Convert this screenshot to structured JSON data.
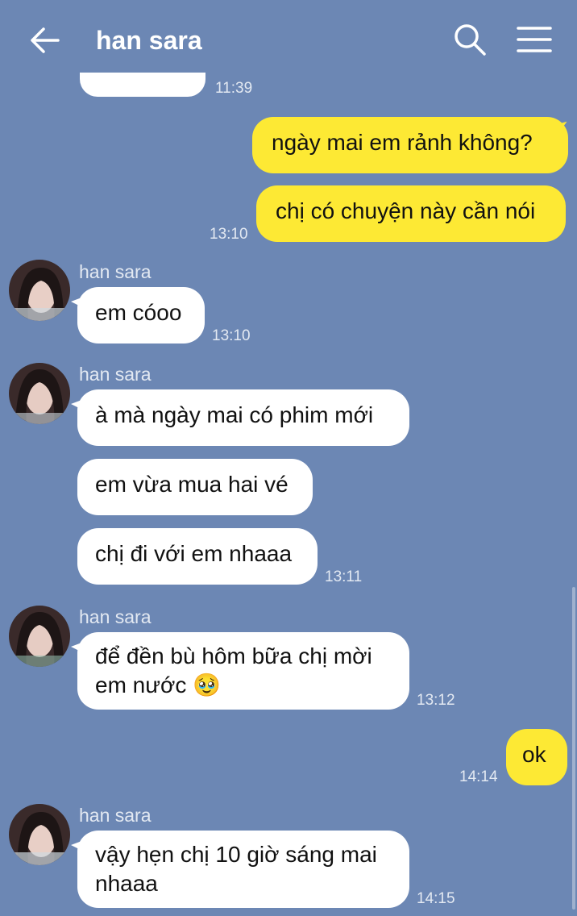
{
  "header": {
    "title": "han sara"
  },
  "partial_top": {
    "time": "11:39"
  },
  "messages": {
    "out1": {
      "text": "ngày mai em rảnh không?"
    },
    "out2": {
      "text": "chị có chuyện này cần nói",
      "time": "13:10"
    },
    "in1": {
      "sender": "han sara",
      "text": "em cóoo",
      "time": "13:10"
    },
    "in2": {
      "sender": "han sara",
      "text1": "à mà ngày mai có phim mới",
      "text2": "em vừa mua hai vé",
      "text3": "chị đi với em nhaaa",
      "time": "13:11"
    },
    "in3": {
      "sender": "han sara",
      "line1": "để đền bù hôm bữa chị mời",
      "line2": "em nước 🥹",
      "time": "13:12"
    },
    "out3": {
      "text": "ok",
      "time": "14:14"
    },
    "in4": {
      "sender": "han sara",
      "line1": "vậy hẹn chị 10 giờ sáng mai",
      "line2": "nhaaa",
      "time": "14:15"
    }
  },
  "colors": {
    "background": "#6c87b4",
    "outgoing_bubble": "#fde934",
    "incoming_bubble": "#ffffff"
  },
  "icons": [
    "back-arrow-icon",
    "search-icon",
    "menu-icon",
    "avatar"
  ]
}
